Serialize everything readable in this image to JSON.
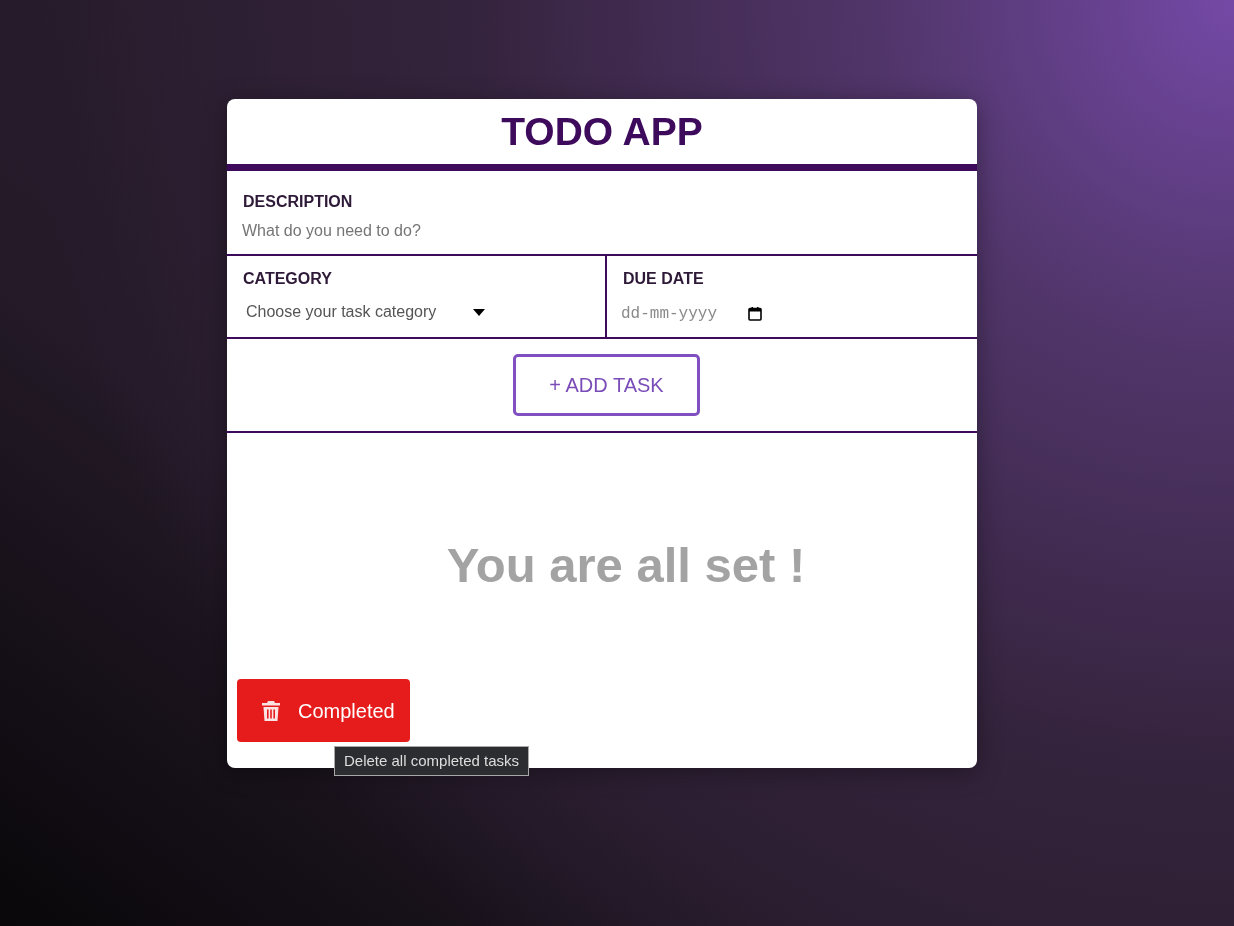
{
  "header": {
    "title": "TODO APP"
  },
  "form": {
    "description": {
      "label": "DESCRIPTION",
      "placeholder": "What do you need to do?"
    },
    "category": {
      "label": "CATEGORY",
      "placeholder": "Choose your task category"
    },
    "due_date": {
      "label": "DUE DATE",
      "placeholder": "dd-mm-yyyy"
    },
    "add_button": "+ ADD TASK"
  },
  "tasks": {
    "empty_message": "You are all set !"
  },
  "clear_button": {
    "label": "Completed",
    "tooltip": "Delete all completed tasks"
  }
}
